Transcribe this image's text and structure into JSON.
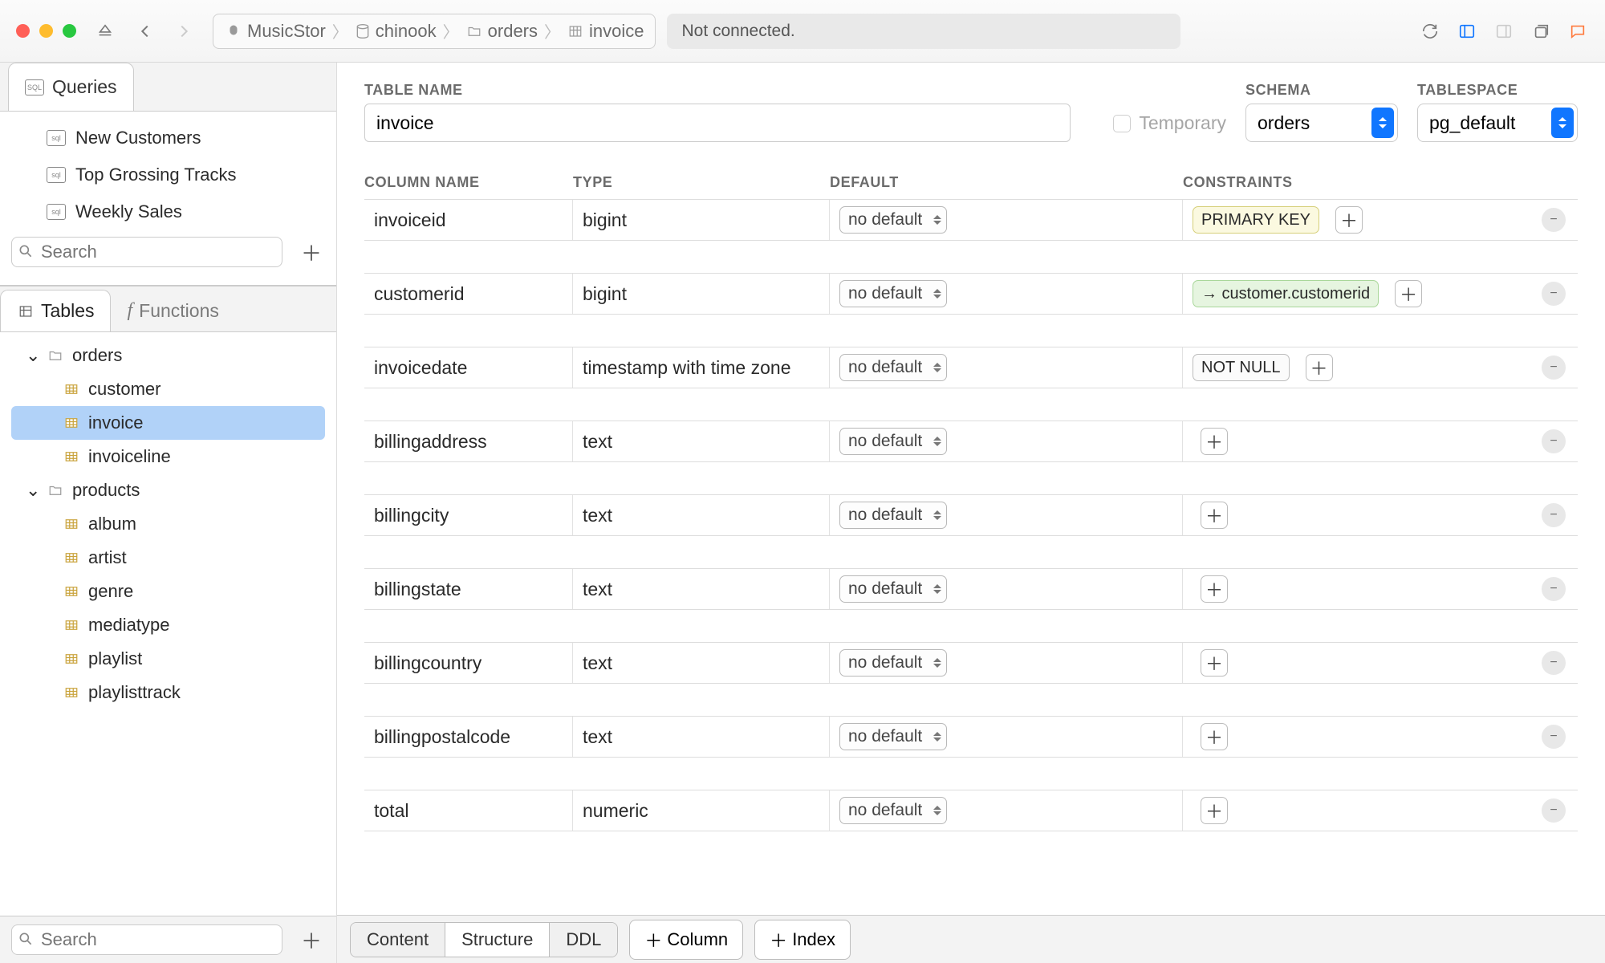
{
  "toolbar": {
    "breadcrumb": [
      "MusicStor",
      "chinook",
      "orders",
      "invoice"
    ],
    "status": "Not connected."
  },
  "sidebar": {
    "queries_tab": "Queries",
    "queries": [
      "New Customers",
      "Top Grossing Tracks",
      "Weekly Sales"
    ],
    "search_placeholder": "Search",
    "tabs": {
      "tables": "Tables",
      "functions": "Functions"
    },
    "tree": [
      {
        "label": "orders",
        "kind": "schema",
        "expanded": true,
        "children": [
          {
            "label": "customer",
            "kind": "table"
          },
          {
            "label": "invoice",
            "kind": "table",
            "selected": true
          },
          {
            "label": "invoiceline",
            "kind": "table"
          }
        ]
      },
      {
        "label": "products",
        "kind": "schema",
        "expanded": true,
        "children": [
          {
            "label": "album",
            "kind": "table"
          },
          {
            "label": "artist",
            "kind": "table"
          },
          {
            "label": "genre",
            "kind": "table"
          },
          {
            "label": "mediatype",
            "kind": "table"
          },
          {
            "label": "playlist",
            "kind": "table"
          },
          {
            "label": "playlisttrack",
            "kind": "table"
          }
        ]
      }
    ],
    "bottom_search_placeholder": "Search"
  },
  "editor": {
    "labels": {
      "table_name": "TABLE NAME",
      "schema": "SCHEMA",
      "tablespace": "TABLESPACE",
      "temporary": "Temporary",
      "column_name": "COLUMN NAME",
      "type": "TYPE",
      "default": "DEFAULT",
      "constraints": "CONSTRAINTS"
    },
    "table_name": "invoice",
    "schema": "orders",
    "tablespace": "pg_default",
    "default_label": "no default",
    "columns": [
      {
        "name": "invoiceid",
        "type": "bigint",
        "constraints": [
          {
            "text": "PRIMARY KEY",
            "kind": "pk"
          }
        ]
      },
      {
        "name": "customerid",
        "type": "bigint",
        "constraints": [
          {
            "text": "→ customer.customerid",
            "kind": "fk"
          }
        ]
      },
      {
        "name": "invoicedate",
        "type": "timestamp with time zone",
        "constraints": [
          {
            "text": "NOT NULL",
            "kind": "plain"
          }
        ]
      },
      {
        "name": "billingaddress",
        "type": "text",
        "constraints": []
      },
      {
        "name": "billingcity",
        "type": "text",
        "constraints": []
      },
      {
        "name": "billingstate",
        "type": "text",
        "constraints": []
      },
      {
        "name": "billingcountry",
        "type": "text",
        "constraints": []
      },
      {
        "name": "billingpostalcode",
        "type": "text",
        "constraints": []
      },
      {
        "name": "total",
        "type": "numeric",
        "constraints": []
      }
    ]
  },
  "footer": {
    "segments": [
      "Content",
      "Structure",
      "DDL"
    ],
    "active_segment": 1,
    "add_column": "Column",
    "add_index": "Index"
  }
}
